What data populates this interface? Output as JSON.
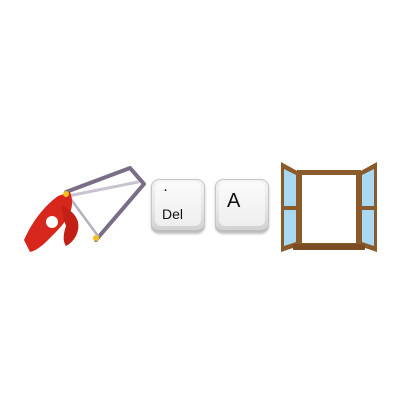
{
  "icons": {
    "saw": "hacksaw-icon",
    "window": "open-window-icon"
  },
  "keys": {
    "del": {
      "dot": "·",
      "label": "Del"
    },
    "a": {
      "label": "A"
    }
  },
  "colors": {
    "saw_handle": "#d7261c",
    "saw_frame": "#7a6e86",
    "saw_blade": "#c9c2cf",
    "saw_bolt": "#f2c21b",
    "window_frame": "#8a5a2b",
    "window_glass": "#a9d9f2",
    "key_face": "#eeeeee"
  }
}
